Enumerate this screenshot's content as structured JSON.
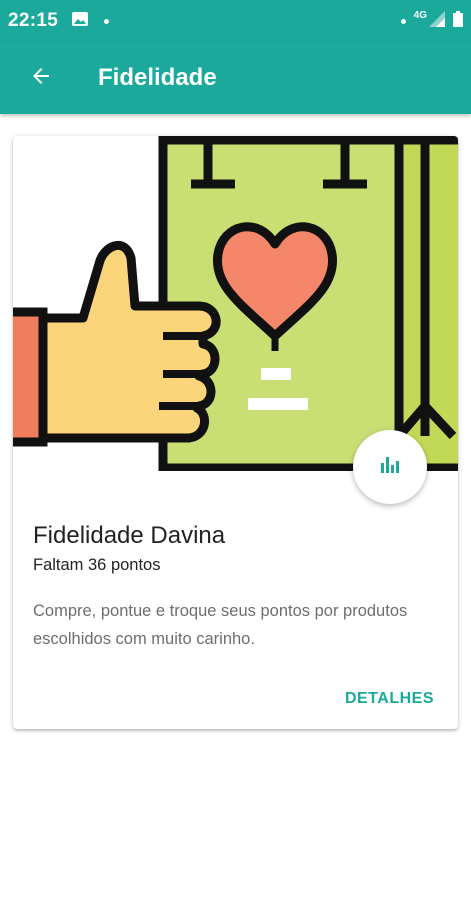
{
  "status_bar": {
    "time": "22:15",
    "network": "4G",
    "icons": [
      "image-icon",
      "notification-dot-icon",
      "signal-icon",
      "battery-icon"
    ]
  },
  "app_bar": {
    "title": "Fidelidade",
    "back_icon": "arrow-back-icon"
  },
  "card": {
    "title": "Fidelidade Davina",
    "subtitle": "Faltam 36 pontos",
    "description": "Compre, pontue e troque seus pontos por produtos escolhidos com muito carinho.",
    "action_label": "DETALHES",
    "fab_icon": "bar-chart-icon",
    "illustration": "thumbs-up-shopping-bag-heart"
  },
  "colors": {
    "primary": "#1aa99a",
    "bag_green": "#c9df74",
    "heart": "#f4866a",
    "hand": "#fcd57b",
    "sleeve": "#ef7d5e"
  }
}
